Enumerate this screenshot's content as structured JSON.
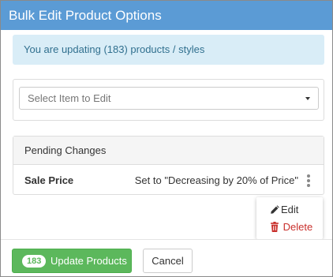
{
  "dialog": {
    "title": "Bulk Edit Product Options"
  },
  "info": {
    "message": "You are updating (183) products / styles"
  },
  "select_item": {
    "placeholder": "Select Item to Edit"
  },
  "pending": {
    "header": "Pending Changes",
    "rows": [
      {
        "field": "Sale Price",
        "change": "Set to \"Decreasing by 20% of Price\""
      }
    ]
  },
  "row_menu": {
    "edit_label": "Edit",
    "delete_label": "Delete"
  },
  "footer": {
    "update_count": "183",
    "update_label": "Update Products",
    "cancel_label": "Cancel"
  },
  "colors": {
    "title_bar": "#5b9bd5",
    "info_bg": "#d9edf7",
    "info_text": "#31708f",
    "primary_green": "#5cb85c",
    "danger_red": "#c9302c"
  },
  "icons": {
    "edit": "pencil-icon",
    "delete": "trash-icon",
    "row_actions": "vertical-ellipsis-icon",
    "select_caret": "caret-down-icon"
  }
}
